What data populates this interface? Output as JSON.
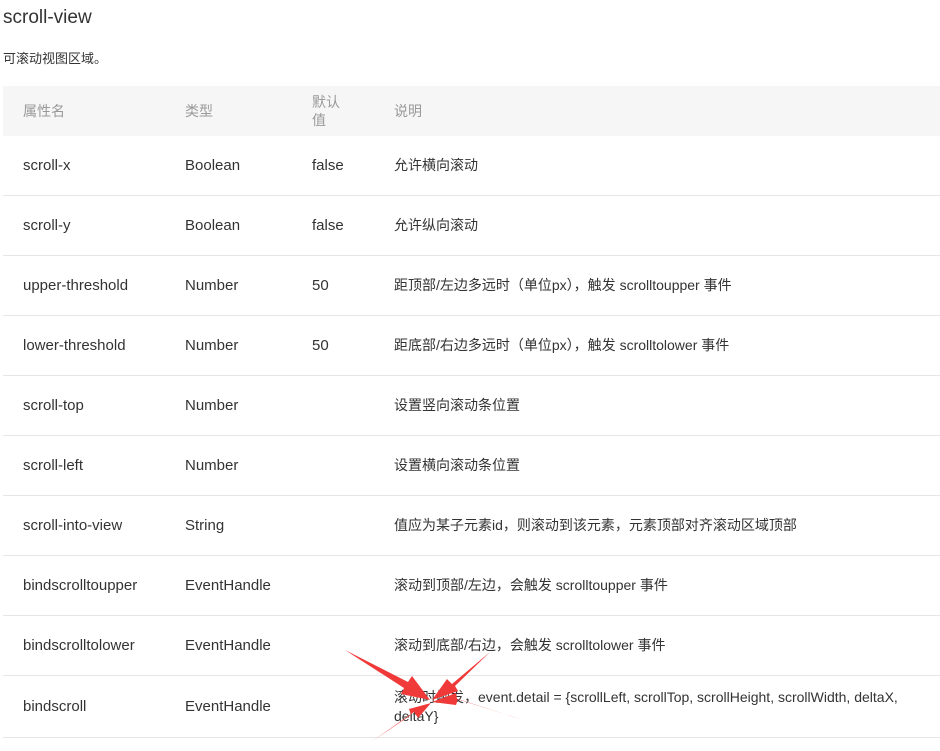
{
  "header": {
    "title": "scroll-view",
    "description": "可滚动视图区域。"
  },
  "table": {
    "columns": [
      "属性名",
      "类型",
      "默认值",
      "说明"
    ],
    "rows": [
      {
        "name": "scroll-x",
        "type": "Boolean",
        "default": "false",
        "desc": "允许横向滚动"
      },
      {
        "name": "scroll-y",
        "type": "Boolean",
        "default": "false",
        "desc": "允许纵向滚动"
      },
      {
        "name": "upper-threshold",
        "type": "Number",
        "default": "50",
        "desc": "距顶部/左边多远时（单位px），触发 scrolltoupper 事件"
      },
      {
        "name": "lower-threshold",
        "type": "Number",
        "default": "50",
        "desc": "距底部/右边多远时（单位px），触发 scrolltolower 事件"
      },
      {
        "name": "scroll-top",
        "type": "Number",
        "default": "",
        "desc": "设置竖向滚动条位置"
      },
      {
        "name": "scroll-left",
        "type": "Number",
        "default": "",
        "desc": "设置横向滚动条位置"
      },
      {
        "name": "scroll-into-view",
        "type": "String",
        "default": "",
        "desc": "值应为某子元素id，则滚动到该元素，元素顶部对齐滚动区域顶部"
      },
      {
        "name": "bindscrolltoupper",
        "type": "EventHandle",
        "default": "",
        "desc": "滚动到顶部/左边，会触发 scrolltoupper 事件"
      },
      {
        "name": "bindscrolltolower",
        "type": "EventHandle",
        "default": "",
        "desc": "滚动到底部/右边，会触发 scrolltolower 事件"
      },
      {
        "name": "bindscroll",
        "type": "EventHandle",
        "default": "",
        "desc": "滚动时触发，event.detail = {scrollLeft, scrollTop, scrollHeight, scrollWidth, deltaX, deltaY}"
      }
    ]
  },
  "annotation": {
    "arrow_color": "#f03a3a"
  }
}
